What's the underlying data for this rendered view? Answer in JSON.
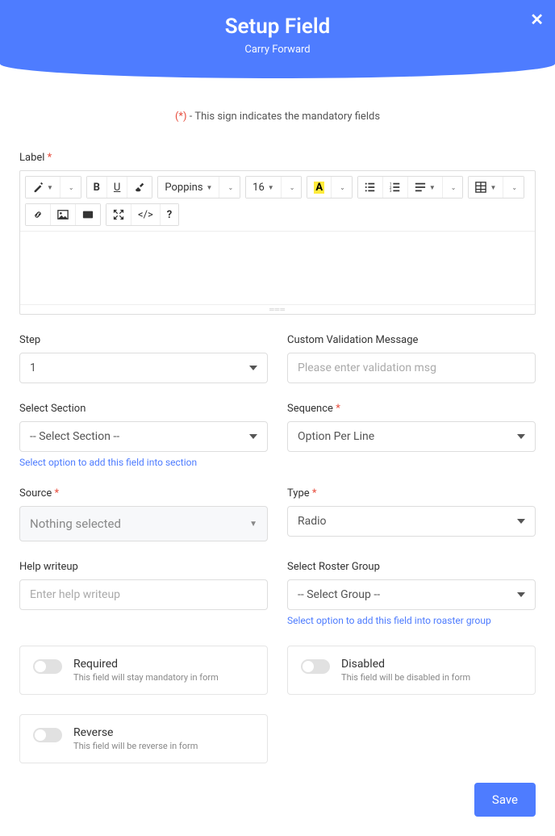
{
  "header": {
    "title": "Setup Field",
    "subtitle": "Carry Forward"
  },
  "mandatory": {
    "symbol": "(*)",
    "text": " - This sign indicates the mandatory fields"
  },
  "labels": {
    "label": "Label",
    "step": "Step",
    "custom_validation": "Custom Validation Message",
    "select_section": "Select Section",
    "sequence": "Sequence",
    "source": "Source",
    "type": "Type",
    "help_writeup": "Help writeup",
    "roster_group": "Select Roster Group"
  },
  "editor": {
    "font_name": "Poppins",
    "font_size": "16"
  },
  "fields": {
    "step_value": "1",
    "validation_placeholder": "Please enter validation msg",
    "section_value": "-- Select Section --",
    "section_hint": "Select option to add this field into section",
    "sequence_value": "Option Per Line",
    "source_value": "Nothing selected",
    "type_value": "Radio",
    "help_placeholder": "Enter help writeup",
    "roster_value": "-- Select Group --",
    "roster_hint": "Select option to add this field into roaster group"
  },
  "toggles": {
    "required": {
      "title": "Required",
      "desc": "This field will stay mandatory in form"
    },
    "disabled": {
      "title": "Disabled",
      "desc": "This field will be disabled in form"
    },
    "reverse": {
      "title": "Reverse",
      "desc": "This field will be reverse in form"
    }
  },
  "buttons": {
    "save": "Save"
  }
}
